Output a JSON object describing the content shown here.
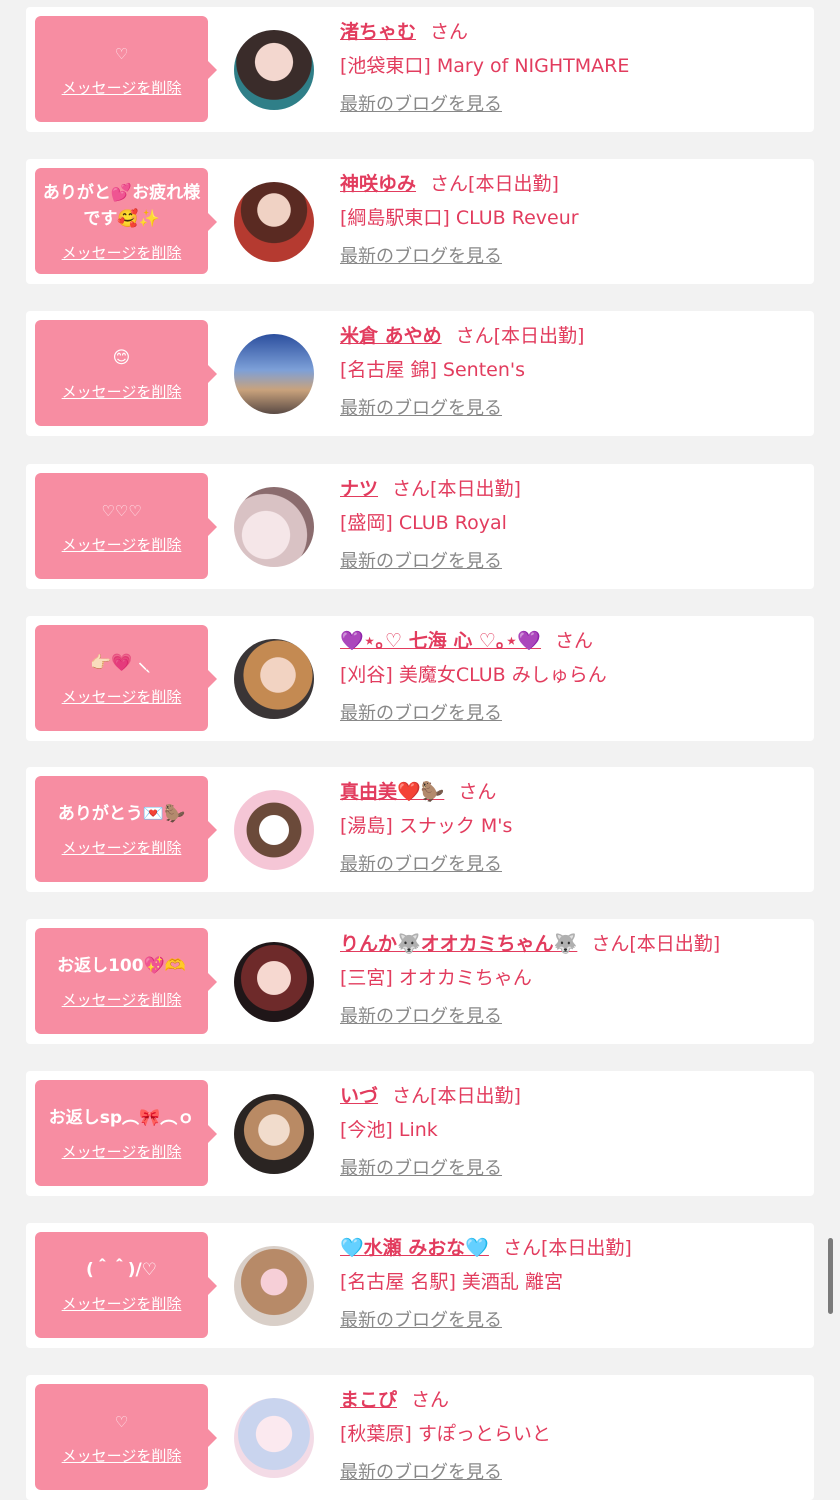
{
  "delete_label": "メッセージを削除",
  "blog_label": "最新のブログを見る",
  "san_label": "さん",
  "colors": {
    "page_bg": "#f2f2f2",
    "card_bg": "#ffffff",
    "bubble": "#f78da2",
    "accent": "#e23c5e",
    "link_gray": "#888888"
  },
  "cards": [
    {
      "message": "♡",
      "message_style": "small",
      "name": "渚ちゃむ",
      "attendance": "",
      "shop": "[池袋東口] Mary of NIGHTMARE",
      "avatar": "avatar-photo"
    },
    {
      "message": "ありがと💕お疲れ様です🥰✨",
      "message_style": "bold",
      "name": "神咲ゆみ",
      "attendance": "[本日出勤]",
      "shop": "[綱島駅東口] CLUB Reveur",
      "avatar": "avatar-photo"
    },
    {
      "message": "😊",
      "message_style": "bold",
      "name": "米倉 あやめ",
      "attendance": "[本日出勤]",
      "shop": "[名古屋 錦] Senten's",
      "avatar": "avatar-photo"
    },
    {
      "message": "♡♡♡",
      "message_style": "small",
      "name": "ナツ",
      "attendance": "[本日出勤]",
      "shop": "[盛岡] CLUB Royal",
      "avatar": "avatar-photo"
    },
    {
      "message": "👉🏻💗 ⸜ ̖",
      "message_style": "bold",
      "name": "💜⋆｡♡ 七海 心 ♡｡⋆💜",
      "attendance": "",
      "shop": "[刈谷] 美魔女CLUB みしゅらん",
      "avatar": "avatar-photo"
    },
    {
      "message": "ありがとう💌🦫",
      "message_style": "bold",
      "name": "真由美❤️🦫",
      "attendance": "",
      "shop": "[湯島] スナック M's",
      "avatar": "avatar-photo"
    },
    {
      "message": "お返し100💖🫶",
      "message_style": "bold",
      "name": "りんか🐺オオカミちゃん🐺",
      "attendance": "[本日出勤]",
      "shop": "[三宮] オオカミちゃん",
      "avatar": "avatar-photo"
    },
    {
      "message": "お返しsp︵🎀︵ｏ",
      "message_style": "bold",
      "name": "いづ",
      "attendance": "[本日出勤]",
      "shop": "[今池] Link",
      "avatar": "avatar-photo"
    },
    {
      "message": "(＾＾)/♡",
      "message_style": "bold",
      "name": "🩵水瀬 みおな🩵",
      "attendance": "[本日出勤]",
      "shop": "[名古屋 名駅] 美酒乱 離宮",
      "avatar": "avatar-photo"
    },
    {
      "message": "♡",
      "message_style": "small",
      "name": "まこぴ",
      "attendance": "",
      "shop": "[秋葉原] すぽっとらいと",
      "avatar": "avatar-photo"
    }
  ]
}
